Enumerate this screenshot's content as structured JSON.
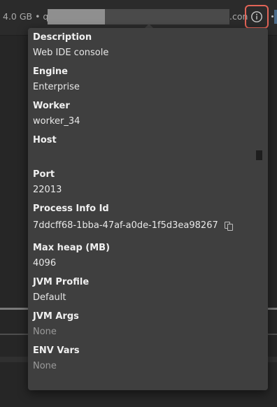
{
  "topbar": {
    "memory_and_host_prefix": "4.0 GB • qa-",
    "host_suffix": ".con",
    "info_button": "info-circle-icon"
  },
  "details": {
    "description": {
      "label": "Description",
      "value": "Web IDE console"
    },
    "engine": {
      "label": "Engine",
      "value": "Enterprise"
    },
    "worker": {
      "label": "Worker",
      "value": "worker_34"
    },
    "host": {
      "label": "Host",
      "value": ""
    },
    "port": {
      "label": "Port",
      "value": "22013"
    },
    "process_info_id": {
      "label": "Process Info Id",
      "value": "7ddcff68-1bba-47af-a0de-1f5d3ea98267",
      "copy_icon": "copy-icon"
    },
    "max_heap": {
      "label": "Max heap (MB)",
      "value": "4096"
    },
    "jvm_profile": {
      "label": "JVM Profile",
      "value": "Default"
    },
    "jvm_args": {
      "label": "JVM Args",
      "value": "None"
    },
    "env_vars": {
      "label": "ENV Vars",
      "value": "None"
    }
  },
  "colors": {
    "highlight_border": "#e26457",
    "popover_bg": "#3f3f3f",
    "muted_text": "#9a9a9a"
  }
}
